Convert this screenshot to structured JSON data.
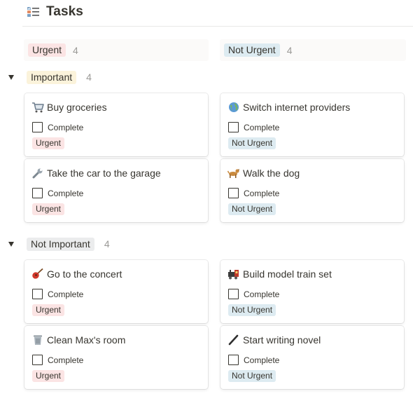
{
  "title": "Tasks",
  "columns": [
    {
      "label": "Urgent",
      "count": "4",
      "color": "#fbe4e4"
    },
    {
      "label": "Not Urgent",
      "count": "4",
      "color": "#ddebf1"
    }
  ],
  "groups": [
    {
      "label": "Important",
      "count": "4",
      "color": "#fbf3db"
    },
    {
      "label": "Not Important",
      "count": "4",
      "color": "#ebeced"
    }
  ],
  "checkbox_label": "Complete",
  "cards": [
    {
      "title": "Buy groceries",
      "icon": "shopping-cart-icon",
      "tag": "Urgent"
    },
    {
      "title": "Switch internet providers",
      "icon": "globe-icon",
      "tag": "Not Urgent"
    },
    {
      "title": "Take the car to the garage",
      "icon": "wrench-icon",
      "tag": "Urgent"
    },
    {
      "title": "Walk the dog",
      "icon": "dog-icon",
      "tag": "Not Urgent"
    },
    {
      "title": "Go to the concert",
      "icon": "guitar-icon",
      "tag": "Urgent"
    },
    {
      "title": "Build model train set",
      "icon": "train-icon",
      "tag": "Not Urgent"
    },
    {
      "title": "Clean Max's room",
      "icon": "trash-can-icon",
      "tag": "Urgent"
    },
    {
      "title": "Start writing novel",
      "icon": "pen-icon",
      "tag": "Not Urgent"
    }
  ]
}
